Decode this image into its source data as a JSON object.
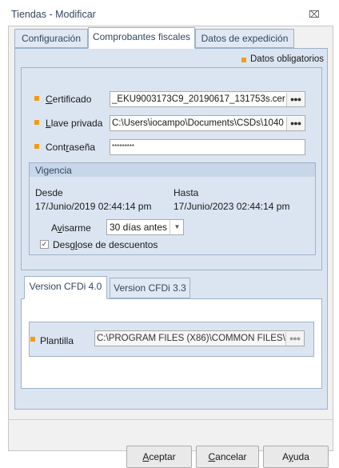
{
  "window": {
    "title": "Tiendas - Modificar",
    "close_glyph": "⌧"
  },
  "tabs": [
    "Configuración",
    "Comprobantes fiscales",
    "Datos de expedición"
  ],
  "required_note": "Datos obligatorios",
  "fields": {
    "certificado": {
      "label": "Certificado",
      "value": "_EKU9003173C9_20190617_131753s.cer"
    },
    "llave": {
      "label": "Llave privada",
      "value": "C:\\Users\\iocampo\\Documents\\CSDs\\1040"
    },
    "password": {
      "label": "Contraseña",
      "value": "*********"
    }
  },
  "vigencia": {
    "title": "Vigencia",
    "desde_label": "Desde",
    "desde_value": "17/Junio/2019 02:44:14 pm",
    "hasta_label": "Hasta",
    "hasta_value": "17/Junio/2023 02:44:14 pm",
    "avisarme_label": "Avisarme",
    "avisarme_value": "30 días antes",
    "desglose_label": "Desglose de descuentos",
    "desglose_checked": true
  },
  "subtabs": [
    "Version CFDi 4.0",
    "Version CFDi 3.3"
  ],
  "plantilla": {
    "label": "Plantilla",
    "value": "C:\\PROGRAM FILES (X86)\\COMMON FILES\\"
  },
  "buttons": {
    "accept": "Aceptar",
    "cancel": "Cancelar",
    "help": "Ayuda"
  },
  "colors": {
    "required_marker": "#f39c12",
    "panel_blue": "#dbe5f1",
    "tab_border": "#9fb2c8"
  }
}
